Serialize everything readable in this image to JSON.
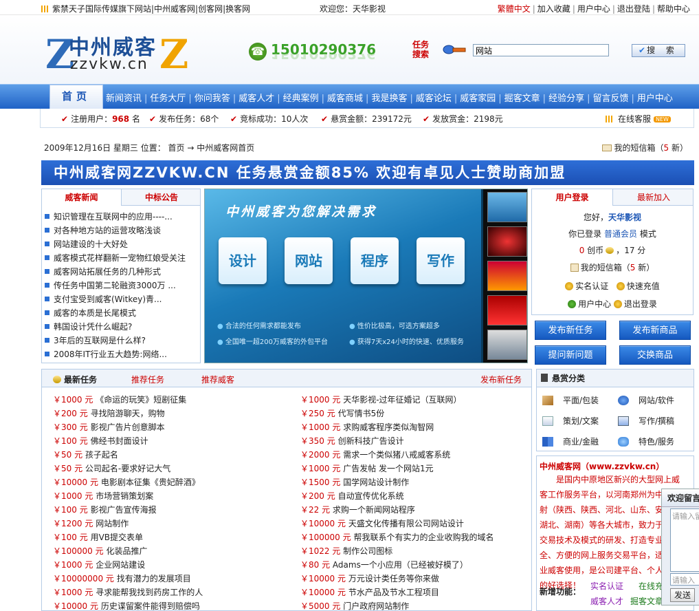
{
  "topbar": {
    "left": "紫禁天子国际传媒旗下网站|中州威客网|创客网|换客网",
    "welcome": "欢迎您：天华影视",
    "links": [
      "繁體中文",
      "加入收藏",
      "用户中心",
      "退出登陆",
      "帮助中心"
    ]
  },
  "logo": {
    "z_left": "Z",
    "z_right": "Z",
    "cn": "中州威客",
    "en": "zzvkw.cn"
  },
  "phone": "15010290376",
  "search": {
    "label_line1": "任务",
    "label_line2": "搜索",
    "value": "网站",
    "button": "搜 索"
  },
  "nav": {
    "home": "首页",
    "items": [
      "新闻资讯",
      "任务大厅",
      "你问我答",
      "威客人才",
      "经典案例",
      "威客商城",
      "我是换客",
      "威客论坛",
      "威客家园",
      "掘客文章",
      "经验分享",
      "留言反馈",
      "用户中心"
    ]
  },
  "stats": {
    "users_label": "注册用户：",
    "users_value": "968",
    "users_unit": " 名",
    "tasks": "发布任务：68个",
    "success": "竞标成功：10人次",
    "reward": "悬赏金额：239172元",
    "paid": "发放赏金：2198元",
    "service": "在线客服",
    "new_badge": "NEW"
  },
  "crumb": "2009年12月16日 星期三  位置： 首页 → 中州威客网首页",
  "mailbox": {
    "label": "我的短信箱（",
    "count": "5",
    "suffix": " 新）"
  },
  "banner": "中州威客网ZZVKW.CN  任务悬赏金额85%  欢迎有卓见人士赞助商加盟",
  "news": {
    "tab1": "威客新闻",
    "tab2": "中标公告",
    "items": [
      "知识管理在互联网中的应用----...",
      "对各种地方站的运营攻略浅谈",
      "网站建设的十大好处",
      "威客模式花样翻新一宠物红娘受关注",
      "威客网站拓展任务的几种形式",
      "传任务中国第二轮融资3000万 ...",
      "支付宝受到威客(Witkey)青...",
      "威客的本质是长尾模式",
      "韩国设计凭什么崛起?",
      "3年后的互联网是什么样?",
      "2008年IT行业五大趋势:网络..."
    ]
  },
  "flash": {
    "title": "中州威客为您解决需求",
    "cards": [
      "设计",
      "网站",
      "程序",
      "写作"
    ],
    "notes": [
      "合法的任何需求都能发布",
      "性价比极高，可选方案超多",
      "全国唯一超200万威客的外包平台",
      "获得7天x24小时的快速、优质服务"
    ]
  },
  "login": {
    "tab1": "用户登录",
    "tab2": "最新加入",
    "hello": "您好，",
    "user": "天华影视",
    "status_prefix": "你已登录 ",
    "level": "普通会员",
    "status_suffix": " 模式",
    "coins": "0",
    "coins_unit": " 创币",
    "score": "17",
    "score_prefix": "，",
    "score_unit": " 分",
    "inbox": "我的短信箱（",
    "inbox_count": "5",
    "inbox_suffix": " 新）",
    "verify": "实名认证",
    "recharge": "快速充值",
    "center": "用户中心",
    "logout": "退出登录"
  },
  "actions": [
    "发布新任务",
    "发布新商品",
    "提问新问题",
    "交换商品"
  ],
  "tasks": {
    "title": "最新任务",
    "tab2": "推荐任务",
    "tab3": "推荐威客",
    "publish": "发布新任务",
    "left": [
      {
        "amount": "￥1000 元",
        "text": "《命运的玩笑》短剧征集"
      },
      {
        "amount": "￥200 元",
        "text": "寻找陪游聊天，购物"
      },
      {
        "amount": "￥300 元",
        "text": "影视广告片创意脚本"
      },
      {
        "amount": "￥100 元",
        "text": "佛经书封面设计"
      },
      {
        "amount": "￥50 元",
        "text": "孩子起名"
      },
      {
        "amount": "￥50 元",
        "text": "公司起名-要求好记大气"
      },
      {
        "amount": "￥10000 元",
        "text": "电影剧本征集《贵妃醉酒》"
      },
      {
        "amount": "￥1000 元",
        "text": "市场营销策划案"
      },
      {
        "amount": "￥100 元",
        "text": "影视广告宣传海报"
      },
      {
        "amount": "￥1200 元",
        "text": "网站制作"
      },
      {
        "amount": "￥100 元",
        "text": "用VB提交表单"
      },
      {
        "amount": "￥100000 元",
        "text": "化装品推广"
      },
      {
        "amount": "￥1000 元",
        "text": "企业网站建设"
      },
      {
        "amount": "￥10000000 元",
        "text": "找有潜力的发展项目"
      },
      {
        "amount": "￥1000 元",
        "text": "寻求能帮我找到药房工作的人"
      },
      {
        "amount": "￥10000 元",
        "text": "历史谍留案件能得到赔偿吗"
      }
    ],
    "right": [
      {
        "amount": "￥1000 元",
        "text": "天华影视-过年征婚记（互联网）"
      },
      {
        "amount": "￥250 元",
        "text": "代写情书5份"
      },
      {
        "amount": "￥1000 元",
        "text": "求购威客程序类似淘智网"
      },
      {
        "amount": "￥350 元",
        "text": "创新科技广告设计"
      },
      {
        "amount": "￥2000 元",
        "text": "需求一个类似猪八戒威客系统"
      },
      {
        "amount": "￥1000 元",
        "text": "广告发帖 发一个网站1元"
      },
      {
        "amount": "￥1500 元",
        "text": "国学网站设计制作"
      },
      {
        "amount": "￥200 元",
        "text": "自动宣传优化系统"
      },
      {
        "amount": "￥22 元",
        "text": "求购一个新闻网站程序"
      },
      {
        "amount": "￥10000 元",
        "text": "天盛文化传播有限公司网站设计"
      },
      {
        "amount": "￥100000 元",
        "text": "帮我联系个有实力的企业收购我的域名"
      },
      {
        "amount": "￥1022 元",
        "text": "制作公司图标"
      },
      {
        "amount": "￥80 元",
        "text": "Adams一个小应用（已经被好模了）"
      },
      {
        "amount": "￥10000 元",
        "text": "万元设计类任务等你来做"
      },
      {
        "amount": "￥10000 元",
        "text": "节水产品及节水工程项目"
      },
      {
        "amount": "￥5000 元",
        "text": "门户政府网站制作"
      }
    ]
  },
  "categories": {
    "title": "悬赏分类",
    "items": [
      "平面/包装",
      "网站/软件",
      "策划/文案",
      "写作/撰稿",
      "商业/金融",
      "特色/服务"
    ]
  },
  "intro": {
    "title": "中州威客网（www.zzvkw.cn）",
    "body": "是国内中原地区新兴的大型网上威客工作服务平台，以河南郑州为中心辐射（陕西、陕西、河北、山东、安徽、湖北、湖南）等各大城市，致力于网上交易技术及模式的研发、打造专业、安全、方便的网上服务交易平台，适合专业威客使用，是公司建平台、个人创业的好选择！",
    "func_label": "新增功能：",
    "funcs": [
      "实名认证",
      "在线充值",
      "威客人才",
      "掘客文章"
    ]
  },
  "message": {
    "title": "欢迎留言",
    "placeholder": "请输入留言",
    "placeholder2": "请输入",
    "send": "发送"
  },
  "colors": {
    "brand_blue": "#1f62c6",
    "accent_red": "#cc0000",
    "accent_orange": "#f0a300"
  }
}
